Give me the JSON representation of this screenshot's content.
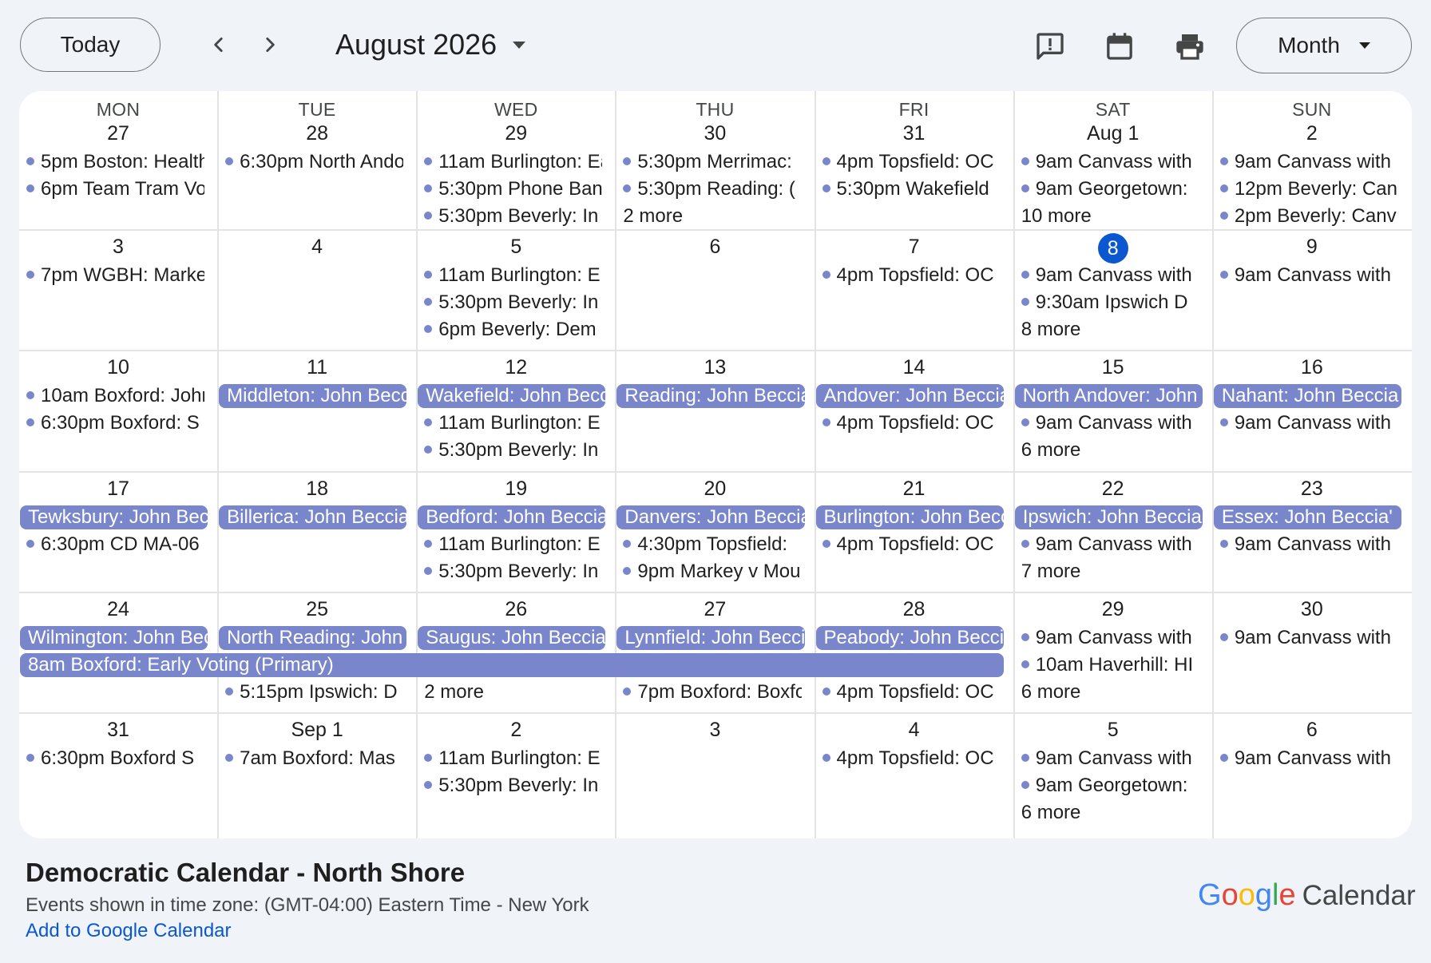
{
  "header": {
    "today_label": "Today",
    "month_label": "August 2026",
    "view_label": "Month",
    "icons": [
      "prev-chevron-icon",
      "next-chevron-icon",
      "feedback-icon",
      "calendar-icon",
      "print-icon"
    ]
  },
  "weekdays": [
    "MON",
    "TUE",
    "WED",
    "THU",
    "FRI",
    "SAT",
    "SUN"
  ],
  "days": [
    {
      "label": "27",
      "today": false,
      "chips": [],
      "events": [
        {
          "time": "5pm",
          "title": "Boston: Health"
        },
        {
          "time": "6pm",
          "title": "Team Tram Volunteer"
        }
      ],
      "more": ""
    },
    {
      "label": "28",
      "today": false,
      "chips": [],
      "events": [
        {
          "time": "6:30pm",
          "title": "North Andover"
        }
      ],
      "more": ""
    },
    {
      "label": "29",
      "today": false,
      "chips": [],
      "events": [
        {
          "time": "11am",
          "title": "Burlington: Early"
        },
        {
          "time": "5:30pm",
          "title": "Phone Bank"
        },
        {
          "time": "5:30pm",
          "title": "Beverly: In"
        }
      ],
      "more": ""
    },
    {
      "label": "30",
      "today": false,
      "chips": [],
      "events": [
        {
          "time": "5:30pm",
          "title": "Merrimac: "
        },
        {
          "time": "5:30pm",
          "title": "Reading: ("
        }
      ],
      "more": "2 more"
    },
    {
      "label": "31",
      "today": false,
      "chips": [],
      "events": [
        {
          "time": "4pm",
          "title": "Topsfield: OC"
        },
        {
          "time": "5:30pm",
          "title": "Wakefield"
        }
      ],
      "more": ""
    },
    {
      "label": "Aug 1",
      "today": false,
      "chips": [],
      "events": [
        {
          "time": "9am",
          "title": "Canvass with"
        },
        {
          "time": "9am",
          "title": "Georgetown:"
        }
      ],
      "more": "10 more"
    },
    {
      "label": "2",
      "today": false,
      "chips": [],
      "events": [
        {
          "time": "9am",
          "title": "Canvass with"
        },
        {
          "time": "12pm",
          "title": "Beverly: Can"
        },
        {
          "time": "2pm",
          "title": "Beverly: Canv"
        }
      ],
      "more": ""
    },
    {
      "label": "3",
      "today": false,
      "chips": [],
      "events": [
        {
          "time": "7pm",
          "title": "WGBH: Market"
        }
      ],
      "more": ""
    },
    {
      "label": "4",
      "today": false,
      "chips": [],
      "events": [],
      "more": ""
    },
    {
      "label": "5",
      "today": false,
      "chips": [],
      "events": [
        {
          "time": "11am",
          "title": "Burlington: E"
        },
        {
          "time": "5:30pm",
          "title": "Beverly: In"
        },
        {
          "time": "6pm",
          "title": "Beverly: Dem"
        }
      ],
      "more": ""
    },
    {
      "label": "6",
      "today": false,
      "chips": [],
      "events": [],
      "more": ""
    },
    {
      "label": "7",
      "today": false,
      "chips": [],
      "events": [
        {
          "time": "4pm",
          "title": "Topsfield: OC"
        }
      ],
      "more": ""
    },
    {
      "label": "8",
      "today": true,
      "chips": [],
      "events": [
        {
          "time": "9am",
          "title": "Canvass with"
        },
        {
          "time": "9:30am",
          "title": "Ipswich D"
        }
      ],
      "more": "8 more"
    },
    {
      "label": "9",
      "today": false,
      "chips": [],
      "events": [
        {
          "time": "9am",
          "title": "Canvass with"
        }
      ],
      "more": ""
    },
    {
      "label": "10",
      "today": false,
      "chips": [],
      "events": [
        {
          "time": "10am",
          "title": "Boxford: John"
        },
        {
          "time": "6:30pm",
          "title": "Boxford: S"
        }
      ],
      "more": ""
    },
    {
      "label": "11",
      "today": false,
      "chips": [
        "Middleton: John Beccia"
      ],
      "events": [],
      "more": ""
    },
    {
      "label": "12",
      "today": false,
      "chips": [
        "Wakefield: John Beccia"
      ],
      "events": [
        {
          "time": "11am",
          "title": "Burlington: E"
        },
        {
          "time": "5:30pm",
          "title": "Beverly: In"
        }
      ],
      "more": ""
    },
    {
      "label": "13",
      "today": false,
      "chips": [
        "Reading: John Beccia"
      ],
      "events": [],
      "more": ""
    },
    {
      "label": "14",
      "today": false,
      "chips": [
        "Andover: John Beccia"
      ],
      "events": [
        {
          "time": "4pm",
          "title": "Topsfield: OC"
        }
      ],
      "more": ""
    },
    {
      "label": "15",
      "today": false,
      "chips": [
        "North Andover: John"
      ],
      "events": [
        {
          "time": "9am",
          "title": "Canvass with"
        }
      ],
      "more": "6 more"
    },
    {
      "label": "16",
      "today": false,
      "chips": [
        "Nahant: John Beccia"
      ],
      "events": [
        {
          "time": "9am",
          "title": "Canvass with"
        }
      ],
      "more": ""
    },
    {
      "label": "17",
      "today": false,
      "chips": [
        "Tewksbury: John Beccia"
      ],
      "events": [
        {
          "time": "6:30pm",
          "title": "CD MA-06"
        }
      ],
      "more": ""
    },
    {
      "label": "18",
      "today": false,
      "chips": [
        "Billerica: John Beccia"
      ],
      "events": [],
      "more": ""
    },
    {
      "label": "19",
      "today": false,
      "chips": [
        "Bedford: John Beccia"
      ],
      "events": [
        {
          "time": "11am",
          "title": "Burlington: E"
        },
        {
          "time": "5:30pm",
          "title": "Beverly: In"
        }
      ],
      "more": ""
    },
    {
      "label": "20",
      "today": false,
      "chips": [
        "Danvers: John Beccia"
      ],
      "events": [
        {
          "time": "4:30pm",
          "title": "Topsfield:"
        },
        {
          "time": "9pm",
          "title": "Markey v Moulton"
        }
      ],
      "more": ""
    },
    {
      "label": "21",
      "today": false,
      "chips": [
        "Burlington: John Beccia"
      ],
      "events": [
        {
          "time": "4pm",
          "title": "Topsfield: OC"
        }
      ],
      "more": ""
    },
    {
      "label": "22",
      "today": false,
      "chips": [
        "Ipswich: John Beccia"
      ],
      "events": [
        {
          "time": "9am",
          "title": "Canvass with"
        }
      ],
      "more": "7 more"
    },
    {
      "label": "23",
      "today": false,
      "chips": [
        "Essex: John Beccia'"
      ],
      "events": [
        {
          "time": "9am",
          "title": "Canvass with"
        }
      ],
      "more": ""
    },
    {
      "label": "24",
      "today": false,
      "chips": [
        "Wilmington: John Beccia"
      ],
      "events": [],
      "more": ""
    },
    {
      "label": "25",
      "today": false,
      "chips": [
        "North Reading: John"
      ],
      "events": [
        {
          "time": "5:15pm",
          "title": "Ipswich: D"
        }
      ],
      "more": ""
    },
    {
      "label": "26",
      "today": false,
      "chips": [
        "Saugus: John Beccia"
      ],
      "events": [],
      "more": "2 more"
    },
    {
      "label": "27",
      "today": false,
      "chips": [
        "Lynnfield: John Beccia"
      ],
      "events": [
        {
          "time": "7pm",
          "title": "Boxford: Boxford"
        }
      ],
      "more": ""
    },
    {
      "label": "28",
      "today": false,
      "chips": [
        "Peabody: John Beccia"
      ],
      "events": [
        {
          "time": "4pm",
          "title": "Topsfield: OC"
        }
      ],
      "more": ""
    },
    {
      "label": "29",
      "today": false,
      "chips": [],
      "events": [
        {
          "time": "9am",
          "title": "Canvass with"
        },
        {
          "time": "10am",
          "title": "Haverhill: HI"
        }
      ],
      "more": "6 more"
    },
    {
      "label": "30",
      "today": false,
      "chips": [],
      "events": [
        {
          "time": "9am",
          "title": "Canvass with"
        }
      ],
      "more": ""
    },
    {
      "label": "31",
      "today": false,
      "chips": [],
      "events": [
        {
          "time": "6:30pm",
          "title": "Boxford S"
        }
      ],
      "more": ""
    },
    {
      "label": "Sep 1",
      "today": false,
      "chips": [],
      "events": [
        {
          "time": "7am",
          "title": "Boxford: Mas"
        }
      ],
      "more": ""
    },
    {
      "label": "2",
      "today": false,
      "chips": [],
      "events": [
        {
          "time": "11am",
          "title": "Burlington: E"
        },
        {
          "time": "5:30pm",
          "title": "Beverly: In"
        }
      ],
      "more": ""
    },
    {
      "label": "3",
      "today": false,
      "chips": [],
      "events": [],
      "more": ""
    },
    {
      "label": "4",
      "today": false,
      "chips": [],
      "events": [
        {
          "time": "4pm",
          "title": "Topsfield: OC"
        }
      ],
      "more": ""
    },
    {
      "label": "5",
      "today": false,
      "chips": [],
      "events": [
        {
          "time": "9am",
          "title": "Canvass with"
        },
        {
          "time": "9am",
          "title": "Georgetown:"
        }
      ],
      "more": "6 more"
    },
    {
      "label": "6",
      "today": false,
      "chips": [],
      "events": [
        {
          "time": "9am",
          "title": "Canvass with"
        }
      ],
      "more": ""
    }
  ],
  "spanning_events": [
    {
      "week": 4,
      "start_col": 0,
      "span": 5,
      "row": 1,
      "label": "8am Boxford: Early Voting (Primary)"
    }
  ],
  "footer": {
    "calendar_name": "Democratic Calendar - North Shore",
    "timezone": "Events shown in time zone: (GMT-04:00) Eastern Time - New York",
    "add_link": "Add to Google Calendar",
    "brand_letters": [
      "G",
      "o",
      "o",
      "g",
      "l",
      "e"
    ],
    "brand_product": "Calendar"
  },
  "colors": {
    "event": "#7986cb",
    "today": "#0b57d0",
    "link": "#0b57d0",
    "background": "#f0f4f9",
    "brand": [
      "#4285f4",
      "#ea4335",
      "#fbbc05",
      "#4285f4",
      "#34a853",
      "#ea4335"
    ]
  }
}
